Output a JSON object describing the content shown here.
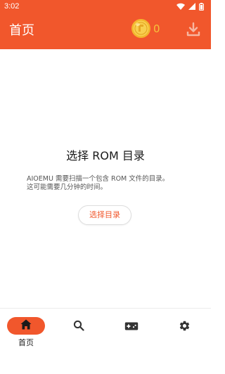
{
  "status_bar": {
    "time": "3:02",
    "icons": [
      "wifi-icon",
      "signal-icon",
      "battery-icon"
    ]
  },
  "app_bar": {
    "title": "首页",
    "coin_count": "0",
    "icons": [
      "coin-icon",
      "download-icon"
    ]
  },
  "main": {
    "title": "选择 ROM 目录",
    "description_line1": "AIOEMU 需要扫描一个包含 ROM 文件的目录。",
    "description_line2": "这可能需要几分钟的时间。",
    "select_button": "选择目录"
  },
  "bottom_nav": {
    "items": [
      {
        "icon": "home-icon",
        "label": "首页",
        "selected": true
      },
      {
        "icon": "search-icon"
      },
      {
        "icon": "gamepad-icon"
      },
      {
        "icon": "settings-icon"
      }
    ]
  },
  "colors": {
    "primary": "#F1572C",
    "coin": "#F5C33B",
    "background": "#FFFFFF"
  }
}
